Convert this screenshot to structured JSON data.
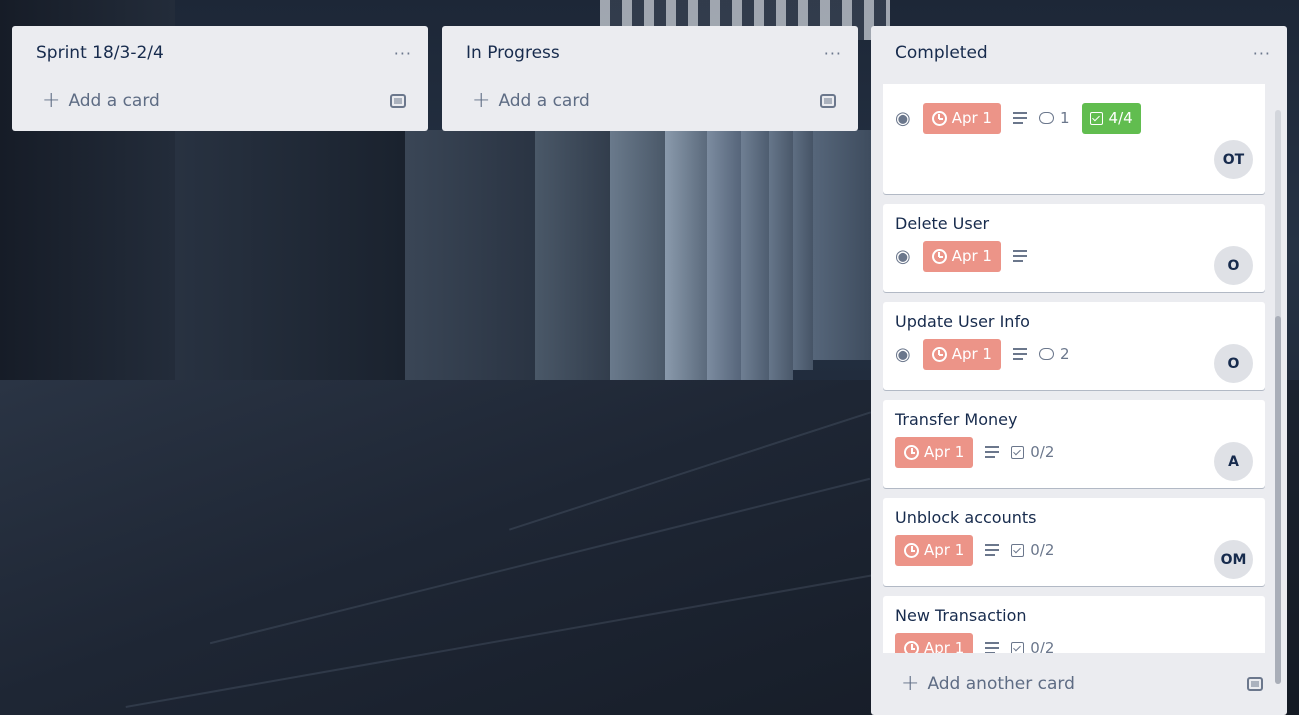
{
  "lists": [
    {
      "title": "Sprint 18/3-2/4",
      "add_label": "Add a card"
    },
    {
      "title": "In Progress",
      "add_label": "Add a card"
    },
    {
      "title": "Completed",
      "add_label": "Add another card"
    }
  ],
  "menu_dots": "···",
  "plus": "+",
  "cards": [
    {
      "title": "",
      "due": "Apr 1",
      "comments": "1",
      "checklist": "4/4",
      "member": "OT"
    },
    {
      "title": "Delete User",
      "due": "Apr 1",
      "member": "O"
    },
    {
      "title": "Update User Info",
      "due": "Apr 1",
      "comments": "2",
      "member": "O"
    },
    {
      "title": "Transfer Money",
      "due": "Apr 1",
      "checklist": "0/2",
      "member": "A"
    },
    {
      "title": "Unblock accounts",
      "due": "Apr 1",
      "checklist": "0/2",
      "member": "OM"
    },
    {
      "title": "New Transaction",
      "due": "Apr 1",
      "checklist": "0/2"
    }
  ],
  "icons": {
    "watch": "eye-icon",
    "due": "clock-icon",
    "description": "description-icon",
    "comments": "comment-icon",
    "checklist": "checklist-icon",
    "template": "card-template-icon"
  },
  "colors": {
    "list_bg": "#ebecf0",
    "due_overdue": "#ec9488",
    "checklist_complete": "#61bd4f",
    "text": "#172b4d"
  }
}
